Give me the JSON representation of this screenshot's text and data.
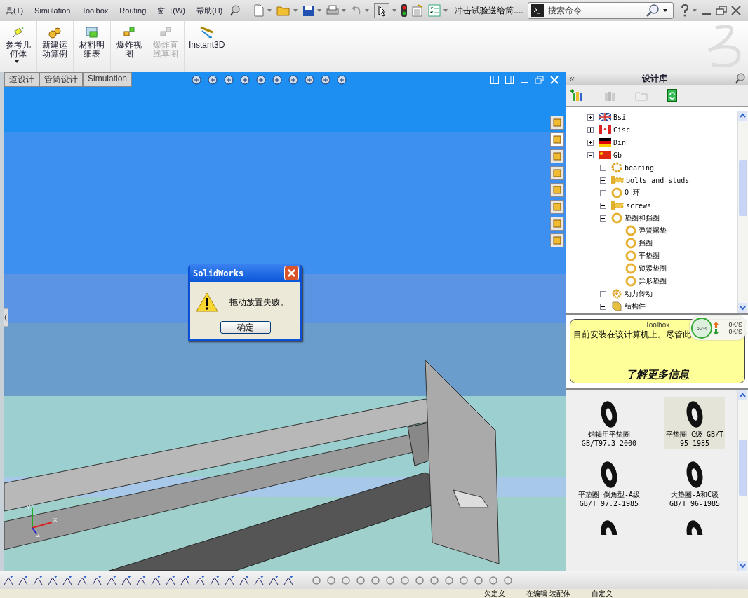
{
  "menu_bar": {
    "items": [
      "具(T)",
      "Simulation",
      "Toolbox",
      "Routing",
      "窗口(W)",
      "帮助(H)"
    ],
    "document_title": "冲击试验送给筒....",
    "search": {
      "placeholder": "搜索命令"
    }
  },
  "ribbon": {
    "buttons": [
      {
        "label": "参考几何体",
        "disabled": false,
        "has_menu": true
      },
      {
        "label": "新建运动算例",
        "disabled": false,
        "has_menu": false
      },
      {
        "label": "材料明细表",
        "disabled": false,
        "has_menu": false
      },
      {
        "label": "爆炸视图",
        "disabled": false,
        "has_menu": false
      },
      {
        "label": "爆炸直线草图",
        "disabled": true,
        "has_menu": false
      },
      {
        "label": "Instant3D",
        "disabled": false,
        "has_menu": false
      }
    ]
  },
  "tabs": [
    {
      "label": "道设计"
    },
    {
      "label": "管筒设计"
    },
    {
      "label": "Simulation"
    }
  ],
  "viewport": {
    "triad": {
      "x": "X",
      "y": "Y",
      "z": "Z"
    }
  },
  "dialog": {
    "title": "SolidWorks",
    "message": "拖动放置失败。",
    "button": "确定"
  },
  "design_library": {
    "title": "设计库",
    "collapse": "«",
    "tree": [
      {
        "label": "Bsi",
        "kind": "uk",
        "expanded": false
      },
      {
        "label": "Cisc",
        "kind": "canada",
        "expanded": false
      },
      {
        "label": "Din",
        "kind": "germany",
        "expanded": false
      },
      {
        "label": "Gb",
        "kind": "china",
        "expanded": true,
        "children": [
          {
            "label": "bearing",
            "kind": "bearing",
            "expanded": false
          },
          {
            "label": "bolts and studs",
            "kind": "bolt",
            "expanded": false
          },
          {
            "label": "O-环",
            "kind": "ring",
            "expanded": false
          },
          {
            "label": "screws",
            "kind": "bolt",
            "expanded": false
          },
          {
            "label": "垫圈和挡圈",
            "kind": "ring",
            "expanded": true,
            "children": [
              {
                "label": "弹簧螺垫",
                "kind": "ring"
              },
              {
                "label": "挡圈",
                "kind": "ring"
              },
              {
                "label": "平垫圈",
                "kind": "ring"
              },
              {
                "label": "锁紧垫圈",
                "kind": "ring"
              },
              {
                "label": "异形垫圈",
                "kind": "ring"
              }
            ]
          },
          {
            "label": "动力传动",
            "kind": "gear",
            "expanded": false
          },
          {
            "label": "结构件",
            "kind": "beam",
            "expanded": false
          }
        ]
      }
    ],
    "info": {
      "title": "Toolbox",
      "text": "目前安装在该计算机上。尽管此",
      "link": "了解更多信息"
    },
    "parts": [
      {
        "name": "销轴用平垫圈",
        "code": "GB/T97.3-2000",
        "selected": false
      },
      {
        "name": "平垫圈 C级 GB/T",
        "code": "95-1985",
        "selected": true
      },
      {
        "name": "平垫圈 倒角型-A级",
        "code": "GB/T 97.2-1985",
        "selected": false
      },
      {
        "name": "大垫圈-A和C级",
        "code": "GB/T 96-1985",
        "selected": false
      }
    ]
  },
  "network_widget": {
    "percent": "52%",
    "upload": "0K/S",
    "download": "0K/S"
  },
  "status_bar": [
    "欠定义",
    "在编辑 装配体",
    "自定义"
  ]
}
